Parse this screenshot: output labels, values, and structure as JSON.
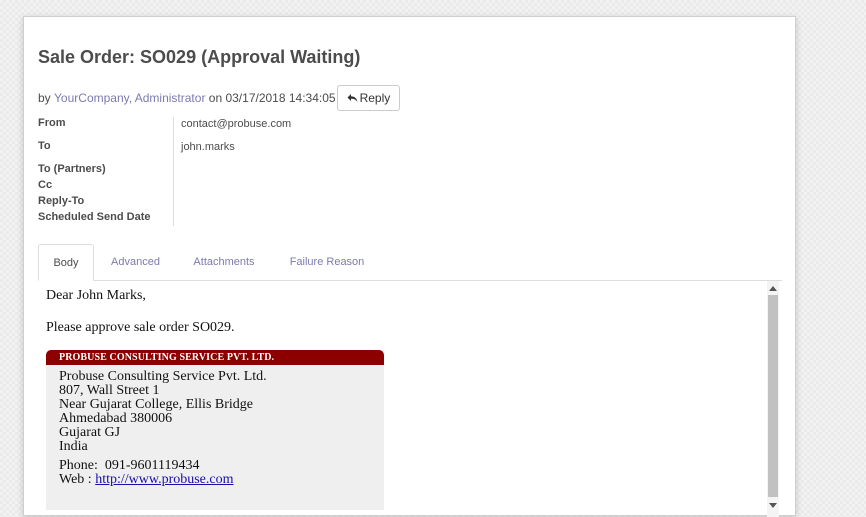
{
  "header": {
    "title": "Sale Order: SO029 (Approval Waiting)",
    "by_prefix": "by",
    "author": "YourCompany, Administrator",
    "date_text": "on 03/17/2018 14:34:05",
    "reply_label": "Reply"
  },
  "fields": {
    "from_label": "From",
    "from_value": "contact@probuse.com",
    "to_label": "To",
    "to_value": "john.marks",
    "to_partners_label": "To (Partners)",
    "cc_label": "Cc",
    "reply_to_label": "Reply-To",
    "scheduled_label": "Scheduled Send Date"
  },
  "tabs": [
    "Body",
    "Advanced",
    "Attachments",
    "Failure Reason"
  ],
  "active_tab": "Body",
  "body": {
    "greeting": "Dear John Marks,",
    "message": "Please approve sale order SO029.",
    "signature": {
      "header": "PROBUSE CONSULTING SERVICE PVT. LTD.",
      "lines": [
        "Probuse Consulting Service Pvt. Ltd.",
        "807, Wall Street 1",
        "Near Gujarat College, Ellis Bridge",
        "Ahmedabad 380006",
        "Gujarat GJ",
        "India"
      ],
      "phone_label": "Phone:",
      "phone": "091-9601119434",
      "web_label": "Web :",
      "web_url": "http://www.probuse.com"
    }
  },
  "colors": {
    "link": "#7c7bad",
    "signature_header_bg": "#8c0000",
    "signature_bg": "#efefef",
    "title": "#4c4c4c"
  },
  "icons": {
    "reply": "reply-icon"
  }
}
